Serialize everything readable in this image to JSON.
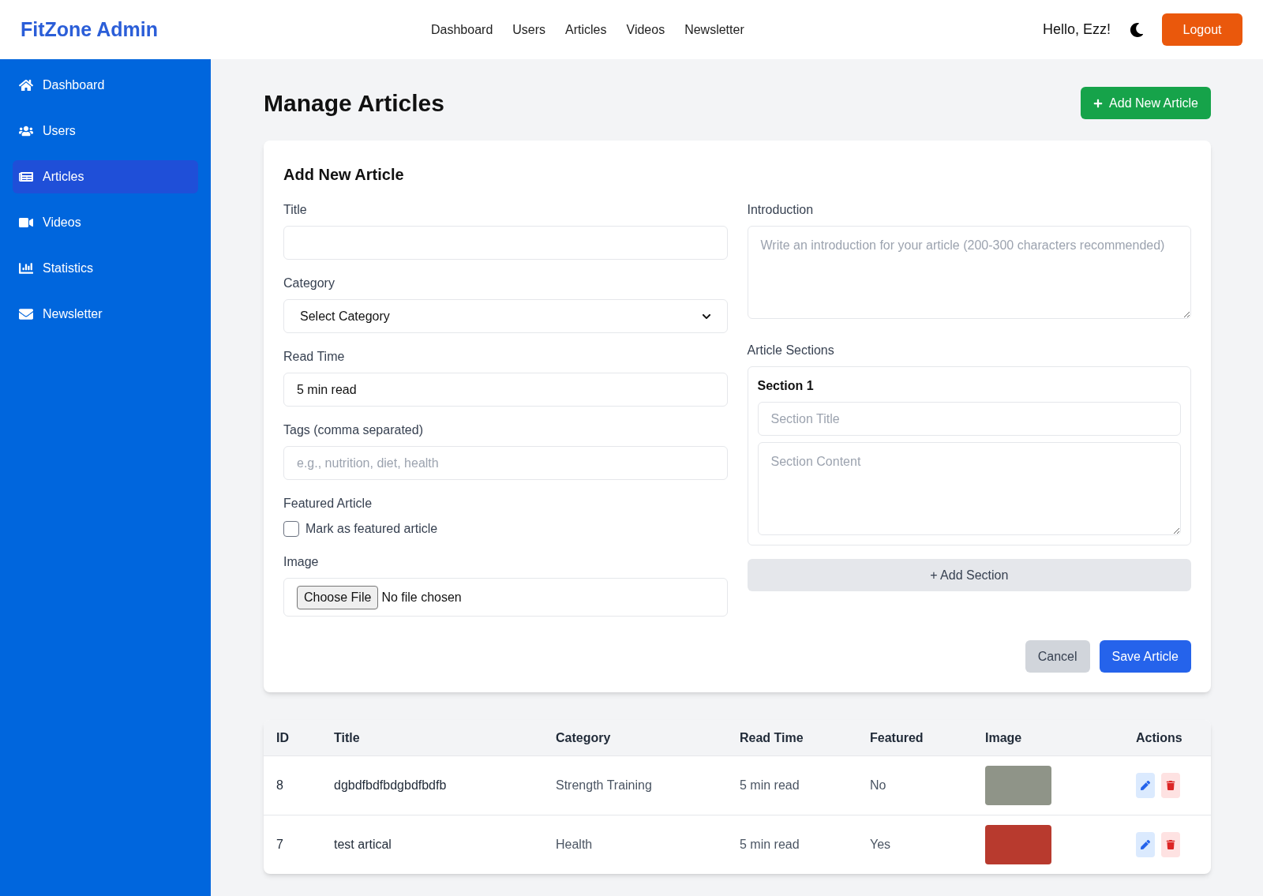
{
  "header": {
    "brand": "FitZone Admin",
    "nav": [
      "Dashboard",
      "Users",
      "Articles",
      "Videos",
      "Newsletter"
    ],
    "greeting": "Hello, Ezz!",
    "logout": "Logout"
  },
  "sidebar": {
    "items": [
      {
        "label": "Dashboard",
        "selected": false
      },
      {
        "label": "Users",
        "selected": false
      },
      {
        "label": "Articles",
        "selected": true
      },
      {
        "label": "Videos",
        "selected": false
      },
      {
        "label": "Statistics",
        "selected": false
      },
      {
        "label": "Newsletter",
        "selected": false
      }
    ]
  },
  "page_title": "Manage Articles",
  "add_button": "Add New Article",
  "form": {
    "title": "Add New Article",
    "left_fields": [
      {
        "kind": "text",
        "label": "Title"
      },
      {
        "kind": "select",
        "label": "Category",
        "value": "Select Category"
      },
      {
        "kind": "text",
        "label": "Read Time",
        "value": "5 min read"
      },
      {
        "kind": "text",
        "label": "Tags (comma separated)",
        "placeholder": "e.g., nutrition, diet, health"
      },
      {
        "kind": "checkbox",
        "label": "Featured Article",
        "option": "Mark as featured article",
        "checked": false
      },
      {
        "kind": "file",
        "label": "Image",
        "button": "Choose File",
        "status": "No file chosen"
      }
    ],
    "introduction": {
      "label": "Introduction",
      "placeholder": "Write an introduction for your article (200-300 characters recommended)"
    },
    "sections": {
      "label": "Article Sections",
      "items": [
        {
          "heading": "Section 1",
          "title_placeholder": "Section Title",
          "content_placeholder": "Section Content"
        }
      ],
      "add_button": "+ Add Section"
    },
    "cancel": "Cancel",
    "save": "Save Article"
  },
  "table": {
    "columns": [
      "ID",
      "Title",
      "Category",
      "Read Time",
      "Featured",
      "Image",
      "Actions"
    ],
    "rows": [
      {
        "id": "8",
        "title": "dgbdfbdfbdgbdfbdfb",
        "category": "Strength Training",
        "read_time": "5 min read",
        "featured": "No"
      },
      {
        "id": "7",
        "title": "test artical",
        "category": "Health",
        "read_time": "5 min read",
        "featured": "Yes"
      }
    ]
  }
}
